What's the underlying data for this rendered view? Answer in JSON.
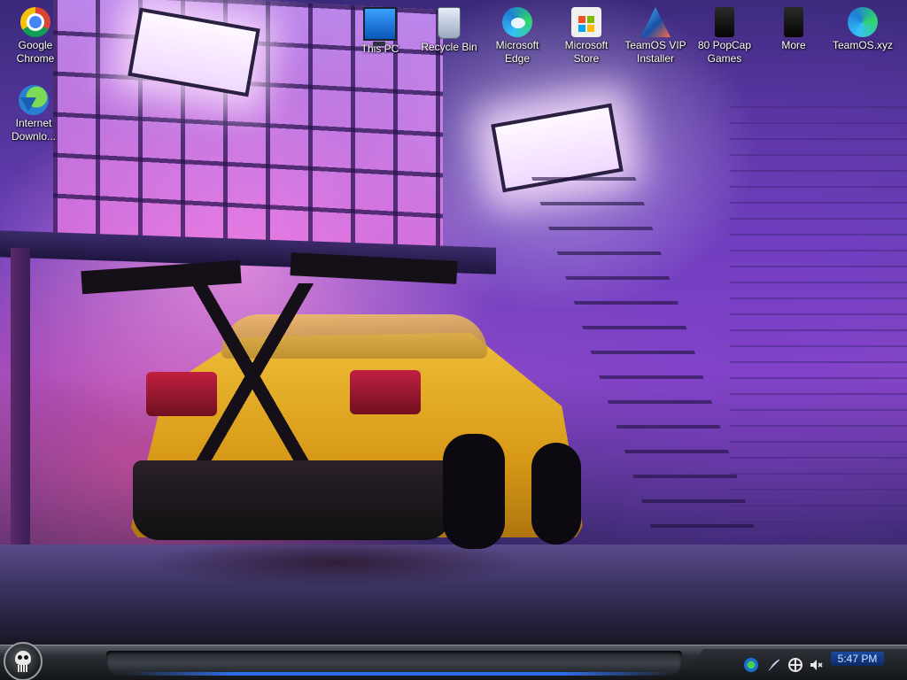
{
  "desktop_icons": [
    {
      "id": "google-chrome",
      "label": "Google Chrome",
      "icon": "chrome-icon"
    },
    {
      "id": "internet-download",
      "label": "Internet Downlo...",
      "icon": "internet-download-manager-icon"
    },
    {
      "id": "this-pc",
      "label": "This PC",
      "icon": "computer-monitor-icon"
    },
    {
      "id": "recycle-bin",
      "label": "Recycle Bin",
      "icon": "recycle-bin-icon"
    },
    {
      "id": "microsoft-edge",
      "label": "Microsoft Edge",
      "icon": "edge-icon"
    },
    {
      "id": "microsoft-store",
      "label": "Microsoft Store",
      "icon": "store-icon"
    },
    {
      "id": "teamos-vip-installer",
      "label": "TeamOS VIP Installer",
      "icon": "teamos-installer-icon"
    },
    {
      "id": "popcap-games",
      "label": "80 PopCap Games",
      "icon": "popcap-games-icon"
    },
    {
      "id": "more",
      "label": "More",
      "icon": "more-icon"
    },
    {
      "id": "teamos-xyz",
      "label": "TeamOS.xyz",
      "icon": "edge-shortcut-icon"
    }
  ],
  "taskbar": {
    "start_icon": "skull-start-icon",
    "tray_icons": [
      "network-icon",
      "feather-icon",
      "globe-icon",
      "speaker-muted-icon"
    ],
    "clock_time": "5:47 PM",
    "accent_color": "#2e6ee8"
  },
  "wallpaper": {
    "subject": "yellow sports car in neon-lit garage",
    "colors": [
      "#8a48c8",
      "#f2c23c",
      "#ff7ad8"
    ]
  }
}
